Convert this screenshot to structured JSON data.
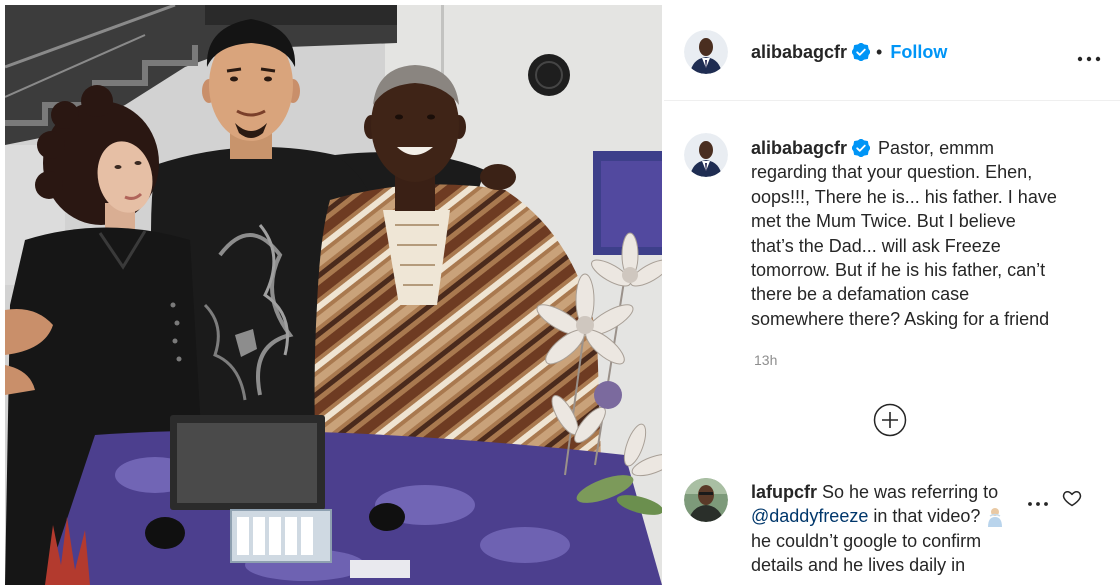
{
  "post": {
    "author": {
      "username": "alibabagcfr",
      "verified": true
    },
    "separator": "•",
    "follow_label": "Follow",
    "more_icon": "more-horizontal-icon"
  },
  "caption": {
    "username": "alibabagcfr",
    "lines": [
      "Pastor, emmm",
      "regarding that your question. Ehen,",
      "oops!!!, There he is... his father. I have",
      "met the Mum Twice. But I believe",
      "that’s the Dad... will ask Freeze",
      "tomorrow. But if he is his father, can’t",
      "there be a defamation case",
      "somewhere there? Asking for a friend"
    ],
    "time": "13h"
  },
  "load_more_icon": "plus-circle-icon",
  "comments": [
    {
      "username": "lafupcfr",
      "first_line": "So he was referring to",
      "mention": "@daddyfreeze",
      "after_mention": "in that video?",
      "emoji_icon": "person-emoji-icon",
      "more_lines": [
        "he couldn’t google to confirm",
        "details and he lives daily in"
      ],
      "more_icon": "more-horizontal-icon",
      "like_icon": "heart-outline-icon"
    }
  ],
  "colors": {
    "accent": "#0095f6",
    "text": "#262626",
    "secondary": "#8e8e8e",
    "mention": "#00376b",
    "divider": "#efefef"
  }
}
